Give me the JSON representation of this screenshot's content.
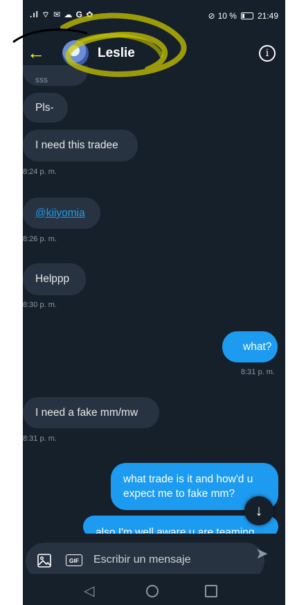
{
  "status_bar": {
    "left_icons": ".ıl ⌔ ✉ ☁ G ✿",
    "right_icons": "⊘",
    "battery": "10 %",
    "time": "21:49"
  },
  "header": {
    "title": "Leslie",
    "back_icon": "arrow-left-icon",
    "info_icon": "info-icon"
  },
  "messages": [
    {
      "direction": "in",
      "text": "sss",
      "partial": true
    },
    {
      "direction": "in",
      "text": "Pls-"
    },
    {
      "direction": "in",
      "text": "I need this tradee",
      "time": "8:24 p. m."
    },
    {
      "direction": "in",
      "text": "@kiiyomia",
      "link": true,
      "time": "8:26 p. m."
    },
    {
      "direction": "in",
      "text": "Helppp",
      "time": "8:30 p. m."
    },
    {
      "direction": "out",
      "text": "what?",
      "time": "8:31 p. m."
    },
    {
      "direction": "in",
      "text": "I need a fake mm/mw",
      "time": "8:31 p. m."
    },
    {
      "direction": "out",
      "text": "what trade is it and how'd u expect me to fake mm?"
    },
    {
      "direction": "out",
      "text": "also I'm well aware u are teaming",
      "partial": true
    }
  ],
  "composer": {
    "placeholder": "Escribir un mensaje",
    "gif_label": "GIF"
  },
  "colors": {
    "background": "#15202b",
    "incoming": "#273340",
    "outgoing": "#1d9bf0",
    "accent": "#ffff33"
  }
}
